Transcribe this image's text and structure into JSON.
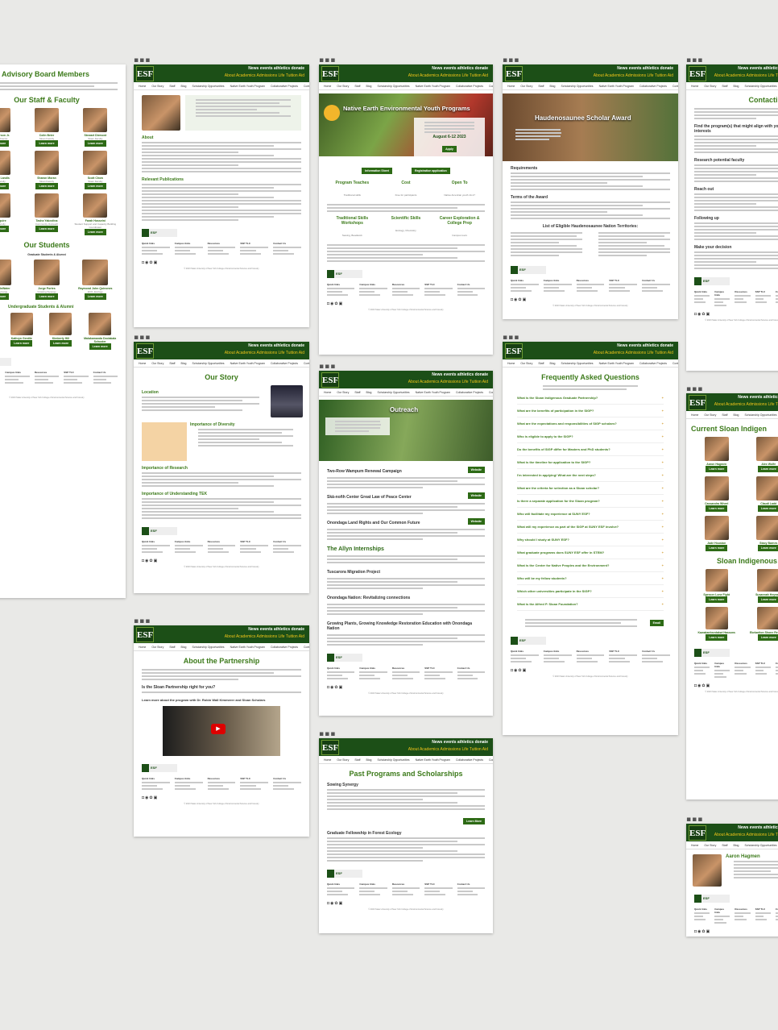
{
  "site": {
    "logo": "ESF",
    "top_links": "News events athletics donate",
    "sub_links": "About Academics Admissions Life Tuition Aid",
    "nav": [
      "Home",
      "Our Story",
      "Staff",
      "Blog",
      "Scholarship Opportunities",
      "Native Earth Youth Program",
      "Collaborative Projects",
      "Contact"
    ],
    "footer_brand": "ESF",
    "footer_cols": [
      "Quick links",
      "Campus links",
      "Resources",
      "SSP TLC",
      "Contact Us"
    ],
    "social": "◘◉✿▣",
    "copyright": "© 2023 State University of New York College of Environmental Science and Forestry"
  },
  "pages": {
    "advisory": {
      "title": "Advisory Board Members",
      "staff_title": "Our Staff & Faculty",
      "students_title": "Our Students",
      "students_sub": "Graduate Students & Alumni",
      "undergrad": "Undergraduate Students & Alumni",
      "people": [
        {
          "name": "Neil Patterson Jr.",
          "role": "Assistant Director"
        },
        {
          "name": "Colin Beier",
          "role": "Sloan Faculty"
        },
        {
          "name": "Stewart Diemont",
          "role": "Sloan Faculty"
        },
        {
          "name": "Catherine Landis",
          "role": "Sloan Faculty"
        },
        {
          "name": "Sharon Moran",
          "role": "Sloan Faculty"
        },
        {
          "name": "Scott Chow",
          "role": "Sloan Faculty"
        },
        {
          "name": "Joan Equire",
          "role": "Sloan Faculty"
        },
        {
          "name": "Tasha Yakovlina",
          "role": "Community Outreach"
        },
        {
          "name": "Farah Hosseini",
          "role": "Student Support and Capacity Building Coordinator"
        }
      ],
      "grads": [
        {
          "name": "Kaya DeerInWater",
          "role": "Growing Synergy"
        },
        {
          "name": "Jorge Portes",
          "role": "Growing Synergy"
        },
        {
          "name": "Raymond John Quinones",
          "role": "ECO, Ecology"
        }
      ],
      "ugrads": [
        {
          "name": "Kathryn Gentile"
        },
        {
          "name": "Kimberly Hill"
        },
        {
          "name": "Malakamanda Dzolakala Schuster"
        }
      ],
      "learn": "Learn more"
    },
    "about": {
      "headings": [
        "About",
        "Relevant Publications"
      ]
    },
    "neep": {
      "title": "Native Earth Environmental Youth Programs",
      "date": "August 6-12 2023",
      "apply": "Apply",
      "cols": [
        {
          "t": "Program Teaches",
          "s": "Traditional skills"
        },
        {
          "t": "Cost",
          "s": "Free for participants"
        },
        {
          "t": "Open To",
          "s": "Native American youth 14-17"
        }
      ],
      "cols2": [
        {
          "t": "Traditional Skills Workshops",
          "s": "Sewing, Beadwork"
        },
        {
          "t": "Scientific Skills",
          "s": "Ecology, Chemistry"
        },
        {
          "t": "Career Exploration & College Prep",
          "s": "Campus tours"
        }
      ],
      "buttons": [
        "Information Sheet",
        "Registration application"
      ]
    },
    "haudeno": {
      "title": "Haudenosaunee Scholar Award",
      "requirements": "Requirements",
      "terms": "Terms of the Award",
      "list": "List of Eligible Haudenosaunee Nation Territories:"
    },
    "contact": {
      "title": "Contacting a",
      "headings": [
        "Find the program(s) that might align with your interests",
        "Research potential faculty",
        "Reach out",
        "Following up",
        "Make your decision"
      ]
    },
    "story": {
      "title": "Our Story",
      "headings": [
        "Location",
        "Importance of Diversity",
        "Importance of Research",
        "Importance of Understanding TEK"
      ]
    },
    "outreach": {
      "title": "Outreach",
      "headings": [
        "Two-Row Wampum Renewal Campaign",
        "Skä-noñh Center Great Law of Peace Center",
        "Onondaga Land Rights and Our Common Future",
        "The Allyn Internships",
        "Tuscarora Migration Project",
        "Onondaga Nation: Revitalizing connections",
        "Growing Plants, Growing Knowledge Restoration Education with Onondaga Nation"
      ],
      "website": "Website"
    },
    "faq": {
      "title": "Frequently Asked Questions",
      "items": [
        "What is the Sloan Indigenous Graduate Partnership?",
        "What are the benefits of participation in the SIGP?",
        "What are the expectations and responsibilities of SIGP scholars?",
        "Who is eligible to apply to the SIGP?",
        "Do the benefits of SIGP differ for Masters and PhD students?",
        "What is the timeline for application to the SIGP?",
        "I'm interested in applying! What are the next steps?",
        "What are the criteria for selection as a Sloan scholar?",
        "Is there a separate application for the Sloan program?",
        "Who will facilitate my experience at SUNY ESF?",
        "What will my experience as part of the SIGP at SUNY ESF involve?",
        "Why should I study at SUNY ESF?",
        "What graduate programs does SUNY ESF offer in STEM?",
        "What is the Center for Native Peoples and the Environment?",
        "Who will be my fellow students?",
        "Which other universities participate in the SIGP?",
        "What is the Alfred P. Sloan Foundation?"
      ],
      "email": "Email"
    },
    "current": {
      "title": "Current Sloan Indigen",
      "sub_title": "Sloan Indigenous",
      "people": [
        {
          "name": "Aaron Hagmen"
        },
        {
          "name": "Alex Wolfe"
        },
        {
          "name": "Cassandra Wheel"
        },
        {
          "name": "Claudi Ladd"
        },
        {
          "name": "Jade Houston"
        },
        {
          "name": "Stacy Barnes"
        }
      ],
      "people2": [
        {
          "name": "Spencer Lone Fight"
        },
        {
          "name": "Susannah Heyward"
        },
        {
          "name": "Kawakanhsedakwi Hassons"
        },
        {
          "name": "Ekelaniton Shone Reinhardt"
        }
      ]
    },
    "partnership": {
      "title": "About the Partnership",
      "q": "Is the Sloan Partnership right for you?",
      "learn": "Learn more about the program with Dr. Robin Wall Kimmerer and Sloan Scholars"
    },
    "past": {
      "title": "Past Programs and Scholarships",
      "headings": [
        "Sowing Synergy",
        "Graduate Fellowship in Forest Ecology"
      ],
      "learn": "Learn More"
    },
    "aaron": {
      "name": "Aaron Hagmen"
    }
  }
}
